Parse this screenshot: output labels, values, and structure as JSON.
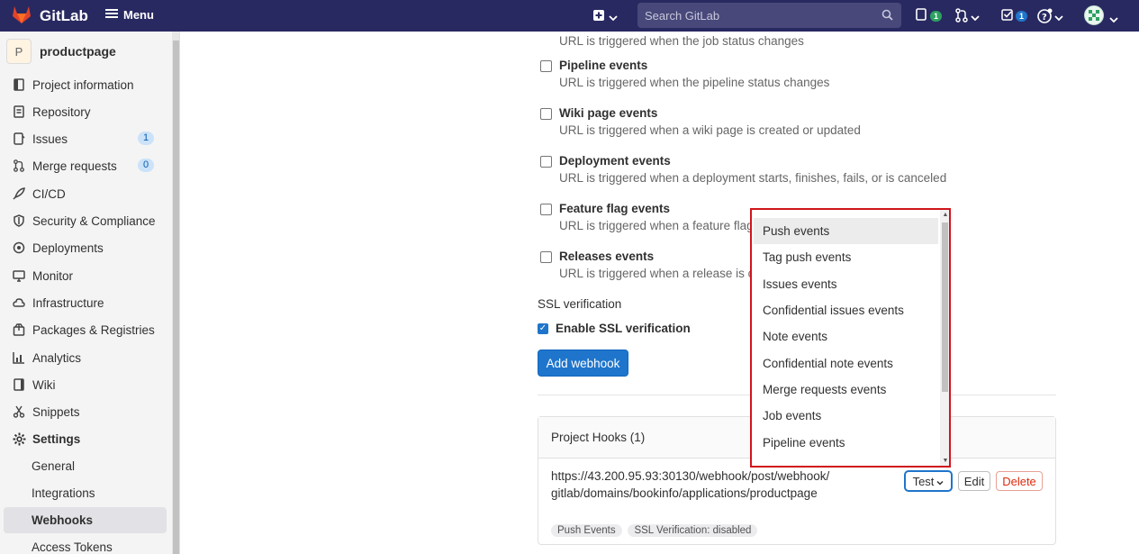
{
  "topbar": {
    "brand": "GitLab",
    "menu_label": "Menu",
    "search_placeholder": "Search GitLab",
    "issues_count": "1",
    "todos_count": "1"
  },
  "sidebar": {
    "project_initial": "P",
    "project_name": "productpage",
    "items": [
      {
        "label": "Project information",
        "icon": "book-icon"
      },
      {
        "label": "Repository",
        "icon": "doc-icon"
      },
      {
        "label": "Issues",
        "icon": "issues-icon",
        "count": "1"
      },
      {
        "label": "Merge requests",
        "icon": "merge-request-icon",
        "count": "0"
      },
      {
        "label": "CI/CD",
        "icon": "rocket-icon"
      },
      {
        "label": "Security & Compliance",
        "icon": "shield-icon"
      },
      {
        "label": "Deployments",
        "icon": "deployments-icon"
      },
      {
        "label": "Monitor",
        "icon": "monitor-icon"
      },
      {
        "label": "Infrastructure",
        "icon": "cloud-icon"
      },
      {
        "label": "Packages & Registries",
        "icon": "package-icon"
      },
      {
        "label": "Analytics",
        "icon": "chart-icon"
      },
      {
        "label": "Wiki",
        "icon": "wiki-icon"
      },
      {
        "label": "Snippets",
        "icon": "scissors-icon"
      },
      {
        "label": "Settings",
        "icon": "gear-icon"
      }
    ],
    "sub_items": [
      "General",
      "Integrations",
      "Webhooks",
      "Access Tokens"
    ]
  },
  "events": [
    {
      "title": "",
      "desc": "URL is triggered when the job status changes"
    },
    {
      "title": "Pipeline events",
      "desc": "URL is triggered when the pipeline status changes"
    },
    {
      "title": "Wiki page events",
      "desc": "URL is triggered when a wiki page is created or updated"
    },
    {
      "title": "Deployment events",
      "desc": "URL is triggered when a deployment starts, finishes, fails, or is canceled"
    },
    {
      "title": "Feature flag events",
      "desc": "URL is triggered when a feature flag is"
    },
    {
      "title": "Releases events",
      "desc": "URL is triggered when a release is crea"
    }
  ],
  "ssl": {
    "section_title": "SSL verification",
    "checkbox_label": "Enable SSL verification"
  },
  "add_webhook_label": "Add webhook",
  "hooks": {
    "header": "Project Hooks (1)",
    "url": "https://43.200.95.93:30130/webhook/post/webhook/gitlab/domains/bookinfo/applications/productpage",
    "tags": [
      "Push Events",
      "SSL Verification: disabled"
    ],
    "test_label": "Test",
    "edit_label": "Edit",
    "delete_label": "Delete"
  },
  "dropdown": {
    "options": [
      "Push events",
      "Tag push events",
      "Issues events",
      "Confidential issues events",
      "Note events",
      "Confidential note events",
      "Merge requests events",
      "Job events",
      "Pipeline events"
    ],
    "highlighted": "Push events"
  },
  "colors": {
    "topbar": "#292961",
    "primary": "#1f75cb",
    "danger": "#dd2b0e",
    "highlight_border": "#d0151c"
  }
}
